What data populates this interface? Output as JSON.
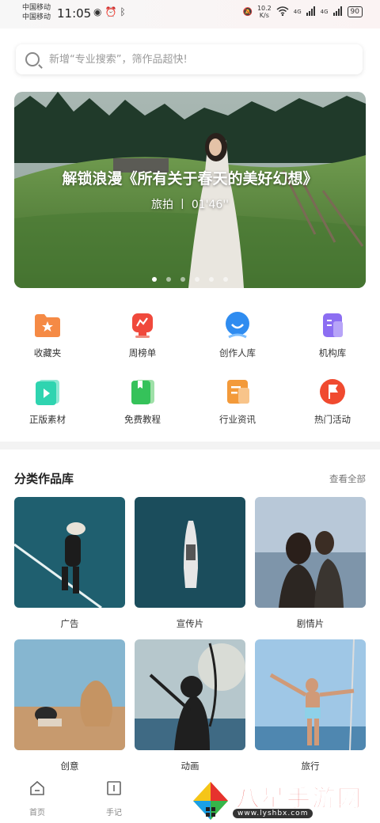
{
  "status_bar": {
    "carrier_1": "中国移动",
    "carrier_2": "中国移动",
    "time": "11:05",
    "net_speed_value": "10.2",
    "net_speed_unit": "K/s",
    "signal_1": "4G",
    "signal_2": "4G",
    "battery": "90"
  },
  "search": {
    "placeholder": "新增“专业搜索”，筛作品超快!"
  },
  "banner": {
    "title": "解锁浪漫《所有关于春天的美好幻想》",
    "subtitle": "旅拍 丨 01'46''",
    "slide_count": 6,
    "active_slide": 1
  },
  "quick_grid": [
    {
      "label": "收藏夹",
      "icon": "folder-star-icon",
      "color": "#f4732a"
    },
    {
      "label": "周榜单",
      "icon": "trophy-icon",
      "color": "#f0443c"
    },
    {
      "label": "创作人库",
      "icon": "creator-icon",
      "color": "#2f8cf0"
    },
    {
      "label": "机构库",
      "icon": "building-icon",
      "color": "#8a6cf0"
    },
    {
      "label": "正版素材",
      "icon": "video-play-icon",
      "color": "#2fd4b0"
    },
    {
      "label": "免费教程",
      "icon": "book-icon",
      "color": "#35c25a"
    },
    {
      "label": "行业资讯",
      "icon": "news-icon",
      "color": "#f0902a"
    },
    {
      "label": "热门活动",
      "icon": "flag-icon",
      "color": "#f04a2f"
    }
  ],
  "category_section": {
    "title": "分类作品库",
    "more": "查看全部",
    "items": [
      {
        "label": "广告"
      },
      {
        "label": "宣传片"
      },
      {
        "label": "剧情片"
      },
      {
        "label": "创意"
      },
      {
        "label": "动画"
      },
      {
        "label": "旅行"
      }
    ]
  },
  "tab_bar": {
    "tabs": [
      {
        "label": "首页",
        "icon": "home-icon"
      },
      {
        "label": "手记",
        "icon": "notebook-icon"
      }
    ]
  },
  "watermark": {
    "name": "八星手游网",
    "url": "www.lyshbx.com"
  }
}
